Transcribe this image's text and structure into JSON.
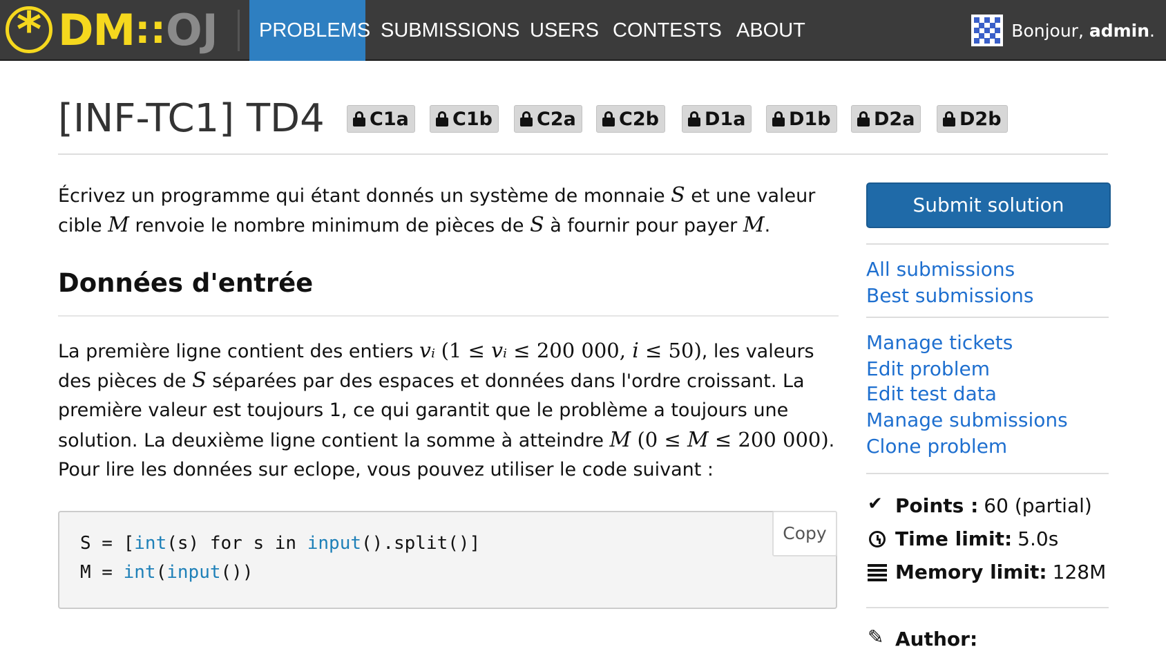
{
  "navbar": {
    "logo": {
      "symbol": "*",
      "dm": "DM",
      "sep": "::",
      "oj": "OJ"
    },
    "items": [
      {
        "label": "PROBLEMS",
        "active": true
      },
      {
        "label": "SUBMISSIONS",
        "active": false
      },
      {
        "label": "USERS",
        "active": false
      },
      {
        "label": "CONTESTS",
        "active": false
      },
      {
        "label": "ABOUT",
        "active": false
      }
    ],
    "user": {
      "greeting": "Bonjour, ",
      "name": "admin",
      "suffix": "."
    },
    "colors": {
      "background": "#3b3b3b",
      "active": "#2e7fc1",
      "logo": "#f5d81e"
    }
  },
  "problem": {
    "title": "[INF-TC1] TD4",
    "badges": [
      "C1a",
      "C1b",
      "C2a",
      "C2b",
      "D1a",
      "D1b",
      "D2a",
      "D2b"
    ]
  },
  "statement": {
    "intro": {
      "t1": "Écrivez un programme qui étant donnés un système de monnaie ",
      "v1": "S",
      "t2": " et une valeur cible ",
      "v2": "M",
      "t3": " renvoie le nombre minimum de pièces de ",
      "v3": "S",
      "t4": " à fournir pour payer ",
      "v4": "M",
      "t5": "."
    },
    "heading": "Données d'entrée",
    "input": {
      "t1": "La première ligne contient des entiers ",
      "m1": "vᵢ",
      "m2": "(1 ≤ ",
      "m3": "vᵢ",
      "m4": " ≤ 200 000, ",
      "m5": "i",
      "m6": " ≤ 50)",
      "t2": ", les valeurs des pièces de ",
      "v1": "S",
      "t3": " séparées par des espaces et données dans l'ordre croissant. La première valeur est toujours 1, ce qui garantit que le problème a toujours une solution. La deuxième ligne contient la somme à atteindre ",
      "v2": "M",
      "m7": " (0 ≤ ",
      "v3": "M",
      "m8": " ≤ 200 000)",
      "t4": ". Pour lire les données sur eclope, vous pouvez utiliser le code suivant :"
    },
    "code": {
      "copy_label": "Copy",
      "line1": {
        "a": "S = [",
        "b": "int",
        "c": "(s) for s in ",
        "d": "input",
        "e": "().split()]"
      },
      "line2": {
        "a": "M = ",
        "b": "int",
        "c": "(",
        "d": "input",
        "e": "())"
      }
    }
  },
  "sidebar": {
    "submit_label": "Submit solution",
    "links_group1": [
      "All submissions",
      "Best submissions"
    ],
    "links_group2": [
      "Manage tickets",
      "Edit problem",
      "Edit test data",
      "Manage submissions",
      "Clone problem"
    ],
    "info": {
      "points_label": "Points :",
      "points_value": "60 (partial)",
      "time_label": "Time limit:",
      "time_value": "5.0s",
      "memory_label": "Memory limit:",
      "memory_value": "128M",
      "author_label": "Author:"
    },
    "colors": {
      "submit": "#1f6aa8",
      "link": "#1e6fcf"
    }
  }
}
